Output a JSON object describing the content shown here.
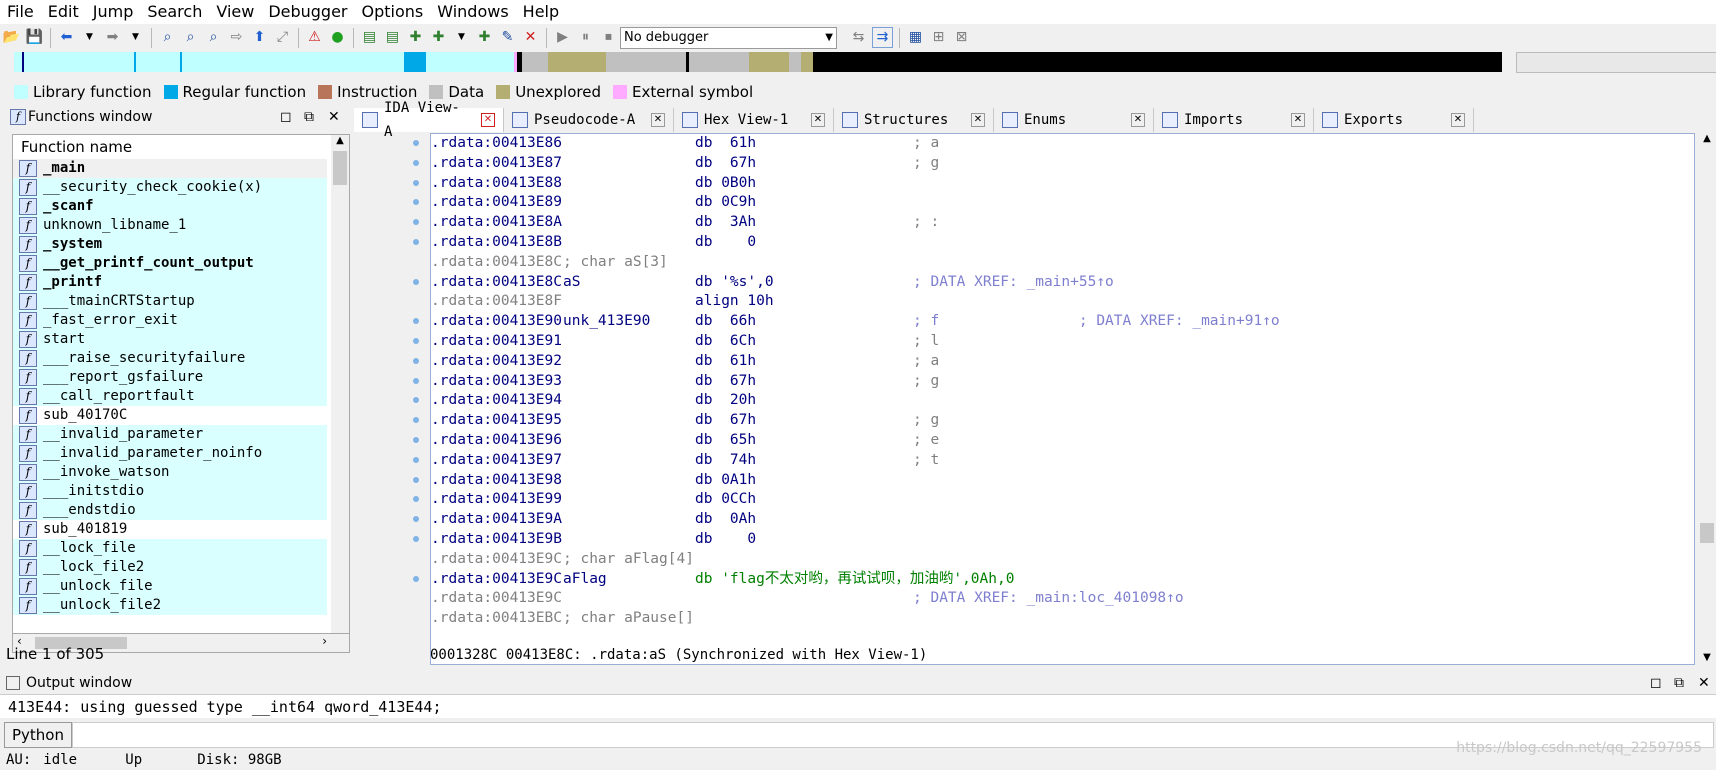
{
  "menu": [
    "File",
    "Edit",
    "Jump",
    "Search",
    "View",
    "Debugger",
    "Options",
    "Windows",
    "Help"
  ],
  "toolbar": {
    "debugger_select": "No debugger"
  },
  "legend": [
    {
      "label": "Library function",
      "color": "#c0ffff"
    },
    {
      "label": "Regular function",
      "color": "#00a8e8"
    },
    {
      "label": "Instruction",
      "color": "#b8755a"
    },
    {
      "label": "Data",
      "color": "#c0c0c0"
    },
    {
      "label": "Unexplored",
      "color": "#b5ae73"
    },
    {
      "label": "External symbol",
      "color": "#ffaaff"
    }
  ],
  "functions_window": {
    "title": "Functions window",
    "column": "Function name",
    "status": "Line 1 of 305",
    "items": [
      {
        "name": "_main",
        "bold": true,
        "lib": false
      },
      {
        "name": "__security_check_cookie(x)",
        "bold": false,
        "lib": true
      },
      {
        "name": "_scanf",
        "bold": true,
        "lib": true
      },
      {
        "name": "unknown_libname_1",
        "bold": false,
        "lib": true
      },
      {
        "name": "_system",
        "bold": true,
        "lib": true
      },
      {
        "name": "__get_printf_count_output",
        "bold": true,
        "lib": true
      },
      {
        "name": "_printf",
        "bold": true,
        "lib": true
      },
      {
        "name": "___tmainCRTStartup",
        "bold": false,
        "lib": true
      },
      {
        "name": "_fast_error_exit",
        "bold": false,
        "lib": true
      },
      {
        "name": "start",
        "bold": false,
        "lib": true
      },
      {
        "name": "___raise_securityfailure",
        "bold": false,
        "lib": true
      },
      {
        "name": "___report_gsfailure",
        "bold": false,
        "lib": true
      },
      {
        "name": "__call_reportfault",
        "bold": false,
        "lib": true
      },
      {
        "name": "sub_40170C",
        "bold": false,
        "lib": false
      },
      {
        "name": "__invalid_parameter",
        "bold": false,
        "lib": true
      },
      {
        "name": "__invalid_parameter_noinfo",
        "bold": false,
        "lib": true
      },
      {
        "name": "__invoke_watson",
        "bold": false,
        "lib": true
      },
      {
        "name": "___initstdio",
        "bold": false,
        "lib": true
      },
      {
        "name": "___endstdio",
        "bold": false,
        "lib": true
      },
      {
        "name": "sub_401819",
        "bold": false,
        "lib": false
      },
      {
        "name": "__lock_file",
        "bold": false,
        "lib": true
      },
      {
        "name": "__lock_file2",
        "bold": false,
        "lib": true
      },
      {
        "name": "__unlock_file",
        "bold": false,
        "lib": true
      },
      {
        "name": "__unlock_file2",
        "bold": false,
        "lib": true
      }
    ]
  },
  "tabs": [
    {
      "label": "IDA View-A",
      "active": true
    },
    {
      "label": "Pseudocode-A",
      "active": false
    },
    {
      "label": "Hex View-1",
      "active": false
    },
    {
      "label": "Structures",
      "active": false
    },
    {
      "label": "Enums",
      "active": false
    },
    {
      "label": "Imports",
      "active": false
    },
    {
      "label": "Exports",
      "active": false
    }
  ],
  "disasm": [
    {
      "addr": ".rdata:00413E86",
      "label": "",
      "op": "db  61h",
      "cmt": "; a",
      "dot": true,
      "gray": false
    },
    {
      "addr": ".rdata:00413E87",
      "label": "",
      "op": "db  67h",
      "cmt": "; g",
      "dot": true,
      "gray": false
    },
    {
      "addr": ".rdata:00413E88",
      "label": "",
      "op": "db 0B0h",
      "cmt": "",
      "dot": true,
      "gray": false
    },
    {
      "addr": ".rdata:00413E89",
      "label": "",
      "op": "db 0C9h",
      "cmt": "",
      "dot": true,
      "gray": false
    },
    {
      "addr": ".rdata:00413E8A",
      "label": "",
      "op": "db  3Ah",
      "cmt": "; :",
      "dot": true,
      "gray": false
    },
    {
      "addr": ".rdata:00413E8B",
      "label": "",
      "op": "db    0",
      "cmt": "",
      "dot": true,
      "gray": false
    },
    {
      "addr": ".rdata:00413E8C",
      "label": "; char aS[3]",
      "op": "",
      "cmt": "",
      "dot": false,
      "gray": true
    },
    {
      "addr": ".rdata:00413E8C",
      "label": "aS",
      "op": "db '%s',0",
      "cmt": "; DATA XREF: _main+55↑o",
      "dot": true,
      "gray": false
    },
    {
      "addr": ".rdata:00413E8F",
      "label": "",
      "op": "align 10h",
      "cmt": "",
      "dot": false,
      "gray": true
    },
    {
      "addr": ".rdata:00413E90",
      "label": "unk_413E90",
      "op": "db  66h",
      "cmt": "; f                ; DATA XREF: _main+91↑o",
      "dot": true,
      "gray": false
    },
    {
      "addr": ".rdata:00413E91",
      "label": "",
      "op": "db  6Ch",
      "cmt": "; l",
      "dot": true,
      "gray": false
    },
    {
      "addr": ".rdata:00413E92",
      "label": "",
      "op": "db  61h",
      "cmt": "; a",
      "dot": true,
      "gray": false
    },
    {
      "addr": ".rdata:00413E93",
      "label": "",
      "op": "db  67h",
      "cmt": "; g",
      "dot": true,
      "gray": false
    },
    {
      "addr": ".rdata:00413E94",
      "label": "",
      "op": "db  20h",
      "cmt": "",
      "dot": true,
      "gray": false
    },
    {
      "addr": ".rdata:00413E95",
      "label": "",
      "op": "db  67h",
      "cmt": "; g",
      "dot": true,
      "gray": false
    },
    {
      "addr": ".rdata:00413E96",
      "label": "",
      "op": "db  65h",
      "cmt": "; e",
      "dot": true,
      "gray": false
    },
    {
      "addr": ".rdata:00413E97",
      "label": "",
      "op": "db  74h",
      "cmt": "; t",
      "dot": true,
      "gray": false
    },
    {
      "addr": ".rdata:00413E98",
      "label": "",
      "op": "db 0A1h",
      "cmt": "",
      "dot": true,
      "gray": false
    },
    {
      "addr": ".rdata:00413E99",
      "label": "",
      "op": "db 0CCh",
      "cmt": "",
      "dot": true,
      "gray": false
    },
    {
      "addr": ".rdata:00413E9A",
      "label": "",
      "op": "db  0Ah",
      "cmt": "",
      "dot": true,
      "gray": false
    },
    {
      "addr": ".rdata:00413E9B",
      "label": "",
      "op": "db    0",
      "cmt": "",
      "dot": true,
      "gray": false
    },
    {
      "addr": ".rdata:00413E9C",
      "label": "; char aFlag[4]",
      "op": "",
      "cmt": "",
      "dot": false,
      "gray": true
    },
    {
      "addr": ".rdata:00413E9C",
      "label": "aFlag",
      "op": "db 'flag不太对哟，再试试呗，加油哟',0Ah,0",
      "cmt": "",
      "dot": true,
      "gray": false
    },
    {
      "addr": ".rdata:00413E9C",
      "label": "",
      "op": "",
      "cmt": "; DATA XREF: _main:loc_401098↑o",
      "dot": false,
      "gray": true
    },
    {
      "addr": ".rdata:00413EBC",
      "label": "; char aPause[]",
      "op": "",
      "cmt": "",
      "dot": false,
      "gray": true
    }
  ],
  "disasm_status": "0001328C 00413E8C: .rdata:aS (Synchronized with Hex View-1)",
  "output": {
    "title": "Output window",
    "text": "413E44: using guessed type __int64 qword_413E44;",
    "python_label": "Python"
  },
  "statusbar": {
    "au": "AU:",
    "state": "idle",
    "dir": "Up",
    "disk": "Disk: 98GB"
  },
  "watermark": "https://blog.csdn.net/qq_22597955"
}
